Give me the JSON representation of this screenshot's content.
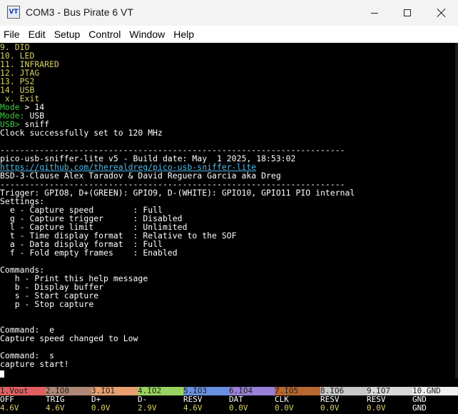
{
  "window": {
    "icon_text": "VT",
    "title": "COM3 - Bus Pirate 6 VT"
  },
  "menu": [
    "File",
    "Edit",
    "Setup",
    "Control",
    "Window",
    "Help"
  ],
  "terminal": {
    "lines": [
      {
        "text": "9. DIO",
        "color": "yellow"
      },
      {
        "text": "10. LED",
        "color": "yellow"
      },
      {
        "text": "11. INFRARED",
        "color": "yellow"
      },
      {
        "text": "12. JTAG",
        "color": "yellow"
      },
      {
        "text": "13. PS2",
        "color": "yellow"
      },
      {
        "text": "14. USB",
        "color": "yellow"
      },
      {
        "text": " x. Exit",
        "color": "yellow"
      },
      {
        "prefix": "Mode",
        "text": " > 14",
        "color": "mixed"
      },
      {
        "prefix": "Mode:",
        "text": " USB",
        "color": "mixed"
      },
      {
        "prefix": "USB>",
        "text": " sniff",
        "color": "mixed"
      },
      {
        "text": "Clock successfully set to 120 MHz",
        "color": "white"
      },
      {
        "text": "",
        "color": "white"
      },
      {
        "text": "----------------------------------------------------------------------",
        "color": "white"
      },
      {
        "text": "pico-usb-sniffer-lite v5 - Build date: May  1 2025, 18:53:02",
        "color": "white"
      },
      {
        "text": "https://github.com/therealdreg/pico-usb-sniffer-lite",
        "color": "link"
      },
      {
        "text": "BSD-3-Clause Alex Taradov & David Reguera Garcia aka Dreg",
        "color": "white"
      },
      {
        "text": "----------------------------------------------------------------------",
        "color": "white"
      },
      {
        "text": "Trigger: GPIO8, D+(GREEN): GPIO9, D-(WHITE): GPIO10, GPIO11 PIO internal",
        "color": "white"
      },
      {
        "text": "Settings:",
        "color": "white"
      },
      {
        "text": "  e - Capture speed        : Full",
        "color": "white"
      },
      {
        "text": "  g - Capture trigger      : Disabled",
        "color": "white"
      },
      {
        "text": "  l - Capture limit        : Unlimited",
        "color": "white"
      },
      {
        "text": "  t - Time display format  : Relative to the SOF",
        "color": "white"
      },
      {
        "text": "  a - Data display format  : Full",
        "color": "white"
      },
      {
        "text": "  f - Fold empty frames    : Enabled",
        "color": "white"
      },
      {
        "text": "",
        "color": "white"
      },
      {
        "text": "Commands:",
        "color": "white"
      },
      {
        "text": "   h - Print this help message",
        "color": "white"
      },
      {
        "text": "   b - Display buffer",
        "color": "white"
      },
      {
        "text": "   s - Start capture",
        "color": "white"
      },
      {
        "text": "   p - Stop capture",
        "color": "white"
      },
      {
        "text": "",
        "color": "white"
      },
      {
        "text": "",
        "color": "white"
      },
      {
        "text": "Command:  e",
        "color": "white"
      },
      {
        "text": "Capture speed changed to Low",
        "color": "white"
      },
      {
        "text": "",
        "color": "white"
      },
      {
        "text": "Command:  s",
        "color": "white"
      },
      {
        "text": "capture start!",
        "color": "white"
      }
    ]
  },
  "pins": [
    {
      "label": "1.Vout",
      "func": "OFF",
      "volt": "4.6V",
      "color": "#e06060"
    },
    {
      "label": "2.IO0",
      "func": "TRIG",
      "volt": "4.6V",
      "color": "#b08878"
    },
    {
      "label": "3.IO1",
      "func": "D+",
      "volt": "0.0V",
      "color": "#e8a070"
    },
    {
      "label": "4.IO2",
      "func": "D-",
      "volt": "2.9V",
      "color": "#9ad460"
    },
    {
      "label": "5.IO3",
      "func": "RESV",
      "volt": "4.6V",
      "color": "#6890e0"
    },
    {
      "label": "6.IO4",
      "func": "DAT",
      "volt": "0.0V",
      "color": "#9a80d8"
    },
    {
      "label": "7.IO5",
      "func": "CLK",
      "volt": "0.0V",
      "color": "#b86830"
    },
    {
      "label": "8.IO6",
      "func": "RESV",
      "volt": "0.0V",
      "color": "#c8c8c8"
    },
    {
      "label": "9.IO7",
      "func": "RESV",
      "volt": "0.0V",
      "color": "#d8d8d8"
    },
    {
      "label": "10.GND",
      "func": "GND",
      "volt": "GND",
      "color": "#f0f0f0"
    }
  ]
}
